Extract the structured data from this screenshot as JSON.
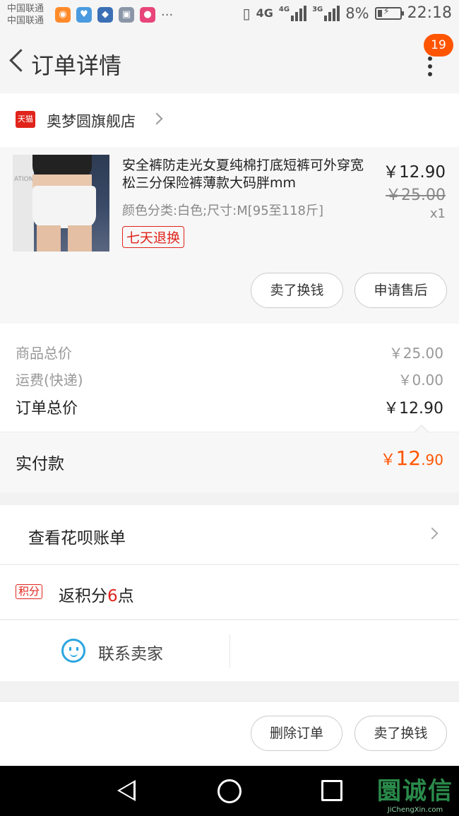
{
  "status_bar": {
    "carrier_1": "中国联通",
    "carrier_2": "中国联通",
    "dots": "···",
    "net_4g_a": "4G",
    "net_4g_b": "4G",
    "net_3g": "3G",
    "battery": "8%",
    "time": "22:18"
  },
  "header": {
    "title": "订单详情",
    "badge": "19"
  },
  "shop": {
    "badge_label": "天猫",
    "name": "奥梦圆旗舰店"
  },
  "product": {
    "image_text": "ATION",
    "name": "安全裤防走光女夏纯棉打底短裤可外穿宽松三分保险裤薄款大码胖mm",
    "spec": "颜色分类:白色;尺寸:M[95至118斤]",
    "tag": "七天退换",
    "price": "￥12.90",
    "original_price": "￥25.00",
    "quantity": "x1",
    "buttons": {
      "resell": "卖了换钱",
      "after_sales": "申请售后"
    }
  },
  "summary": {
    "goods_total_label": "商品总价",
    "goods_total_value": "￥25.00",
    "shipping_label": "运费(快递)",
    "shipping_value": "￥0.00",
    "order_total_label": "订单总价",
    "order_total_value": "￥12.90"
  },
  "paid": {
    "label": "实付款",
    "currency": "￥",
    "integer": "12",
    "decimal": ".90"
  },
  "huabei": {
    "label": "查看花呗账单"
  },
  "points": {
    "tag": "积分",
    "prefix": "返积分",
    "count": "6",
    "suffix": "点"
  },
  "contact": {
    "label": "联系卖家"
  },
  "bottom_actions": {
    "delete": "删除订单",
    "resell": "卖了换钱"
  },
  "watermark": {
    "title": "诚信",
    "logo_glyph": "圜",
    "subtitle": "JiChengXin.com"
  },
  "colors": {
    "accent": "#ff5500",
    "tmall_red": "#e0241b",
    "contact_blue": "#2ba5e0"
  }
}
